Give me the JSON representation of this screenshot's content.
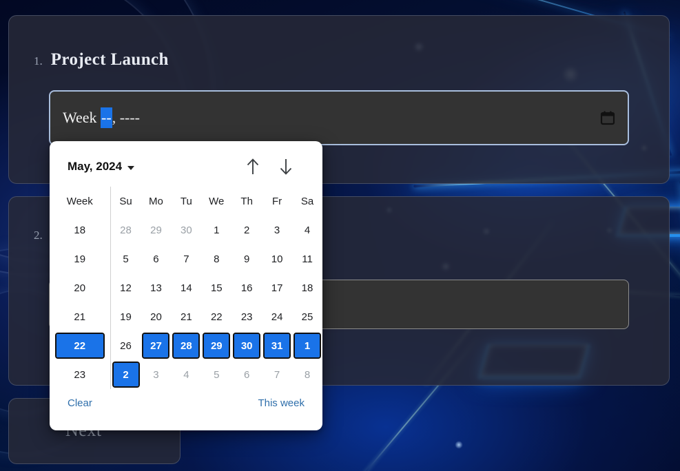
{
  "theme": {
    "accent_blue": "#1a73e8",
    "link_blue": "#2f6fab",
    "card_bg": "#262938",
    "input_bg": "#333333",
    "focus_border": "#a9bedd",
    "popup_bg": "#ffffff",
    "other_month_text": "#9aa0a6"
  },
  "items": [
    {
      "number": "1.",
      "title": "Project Launch"
    },
    {
      "number": "2.",
      "title": ""
    }
  ],
  "week_input": {
    "label_prefix": "Week ",
    "selected_segment": "--",
    "separator": ", ",
    "year_placeholder": "----",
    "full_value": "Week --, ----",
    "calendar_icon": "calendar-icon"
  },
  "second_input": {
    "value": ""
  },
  "next_button": {
    "label": "Next"
  },
  "picker": {
    "month_label": "May, 2024",
    "dropdown_icon": "chevron-down-icon",
    "prev_icon": "arrow-up-icon",
    "next_icon": "arrow-down-icon",
    "headers": [
      "Week",
      "Su",
      "Mo",
      "Tu",
      "We",
      "Th",
      "Fr",
      "Sa"
    ],
    "rows": [
      {
        "week": "18",
        "week_selected": false,
        "days": [
          {
            "d": "28",
            "other": true,
            "sel": false
          },
          {
            "d": "29",
            "other": true,
            "sel": false
          },
          {
            "d": "30",
            "other": true,
            "sel": false
          },
          {
            "d": "1",
            "other": false,
            "sel": false
          },
          {
            "d": "2",
            "other": false,
            "sel": false
          },
          {
            "d": "3",
            "other": false,
            "sel": false
          },
          {
            "d": "4",
            "other": false,
            "sel": false
          }
        ]
      },
      {
        "week": "19",
        "week_selected": false,
        "days": [
          {
            "d": "5",
            "other": false,
            "sel": false
          },
          {
            "d": "6",
            "other": false,
            "sel": false
          },
          {
            "d": "7",
            "other": false,
            "sel": false
          },
          {
            "d": "8",
            "other": false,
            "sel": false
          },
          {
            "d": "9",
            "other": false,
            "sel": false
          },
          {
            "d": "10",
            "other": false,
            "sel": false
          },
          {
            "d": "11",
            "other": false,
            "sel": false
          }
        ]
      },
      {
        "week": "20",
        "week_selected": false,
        "days": [
          {
            "d": "12",
            "other": false,
            "sel": false
          },
          {
            "d": "13",
            "other": false,
            "sel": false
          },
          {
            "d": "14",
            "other": false,
            "sel": false
          },
          {
            "d": "15",
            "other": false,
            "sel": false
          },
          {
            "d": "16",
            "other": false,
            "sel": false
          },
          {
            "d": "17",
            "other": false,
            "sel": false
          },
          {
            "d": "18",
            "other": false,
            "sel": false
          }
        ]
      },
      {
        "week": "21",
        "week_selected": false,
        "days": [
          {
            "d": "19",
            "other": false,
            "sel": false
          },
          {
            "d": "20",
            "other": false,
            "sel": false
          },
          {
            "d": "21",
            "other": false,
            "sel": false
          },
          {
            "d": "22",
            "other": false,
            "sel": false
          },
          {
            "d": "23",
            "other": false,
            "sel": false
          },
          {
            "d": "24",
            "other": false,
            "sel": false
          },
          {
            "d": "25",
            "other": false,
            "sel": false
          }
        ]
      },
      {
        "week": "22",
        "week_selected": true,
        "days": [
          {
            "d": "26",
            "other": false,
            "sel": false
          },
          {
            "d": "27",
            "other": false,
            "sel": true
          },
          {
            "d": "28",
            "other": false,
            "sel": true
          },
          {
            "d": "29",
            "other": false,
            "sel": true
          },
          {
            "d": "30",
            "other": false,
            "sel": true
          },
          {
            "d": "31",
            "other": false,
            "sel": true
          },
          {
            "d": "1",
            "other": false,
            "sel": true
          }
        ]
      },
      {
        "week": "23",
        "week_selected": false,
        "days": [
          {
            "d": "2",
            "other": false,
            "sel": true
          },
          {
            "d": "3",
            "other": true,
            "sel": false
          },
          {
            "d": "4",
            "other": true,
            "sel": false
          },
          {
            "d": "5",
            "other": true,
            "sel": false
          },
          {
            "d": "6",
            "other": true,
            "sel": false
          },
          {
            "d": "7",
            "other": true,
            "sel": false
          },
          {
            "d": "8",
            "other": true,
            "sel": false
          }
        ]
      }
    ],
    "clear_label": "Clear",
    "this_week_label": "This week"
  }
}
